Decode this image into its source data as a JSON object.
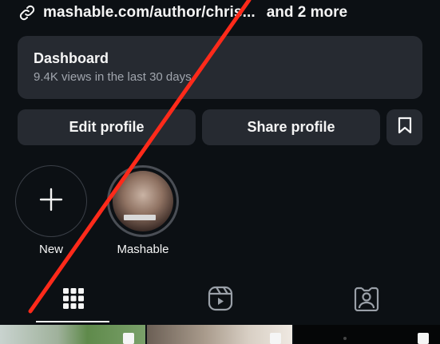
{
  "profile_link": {
    "url_text": "mashable.com/author/chris...",
    "more_text": "and 2 more",
    "icon": "link-icon"
  },
  "dashboard": {
    "title": "Dashboard",
    "subtitle": "9.4K views in the last 30 days."
  },
  "actions": {
    "edit_label": "Edit profile",
    "share_label": "Share profile",
    "save_icon": "bookmark-icon"
  },
  "highlights": [
    {
      "label": "New",
      "icon": "plus-icon"
    },
    {
      "label": "Mashable",
      "icon": "highlight-cover-photo"
    }
  ],
  "tabs": [
    {
      "name": "posts-grid",
      "icon": "grid-icon",
      "active": true
    },
    {
      "name": "reels",
      "icon": "reels-icon",
      "active": false
    },
    {
      "name": "tagged",
      "icon": "tagged-person-icon",
      "active": false
    }
  ],
  "colors": {
    "background": "#0c1014",
    "card": "#262a31",
    "text": "#f5f5f5",
    "muted_text": "#a0a5ad",
    "strike_line": "#ff2a1a"
  }
}
